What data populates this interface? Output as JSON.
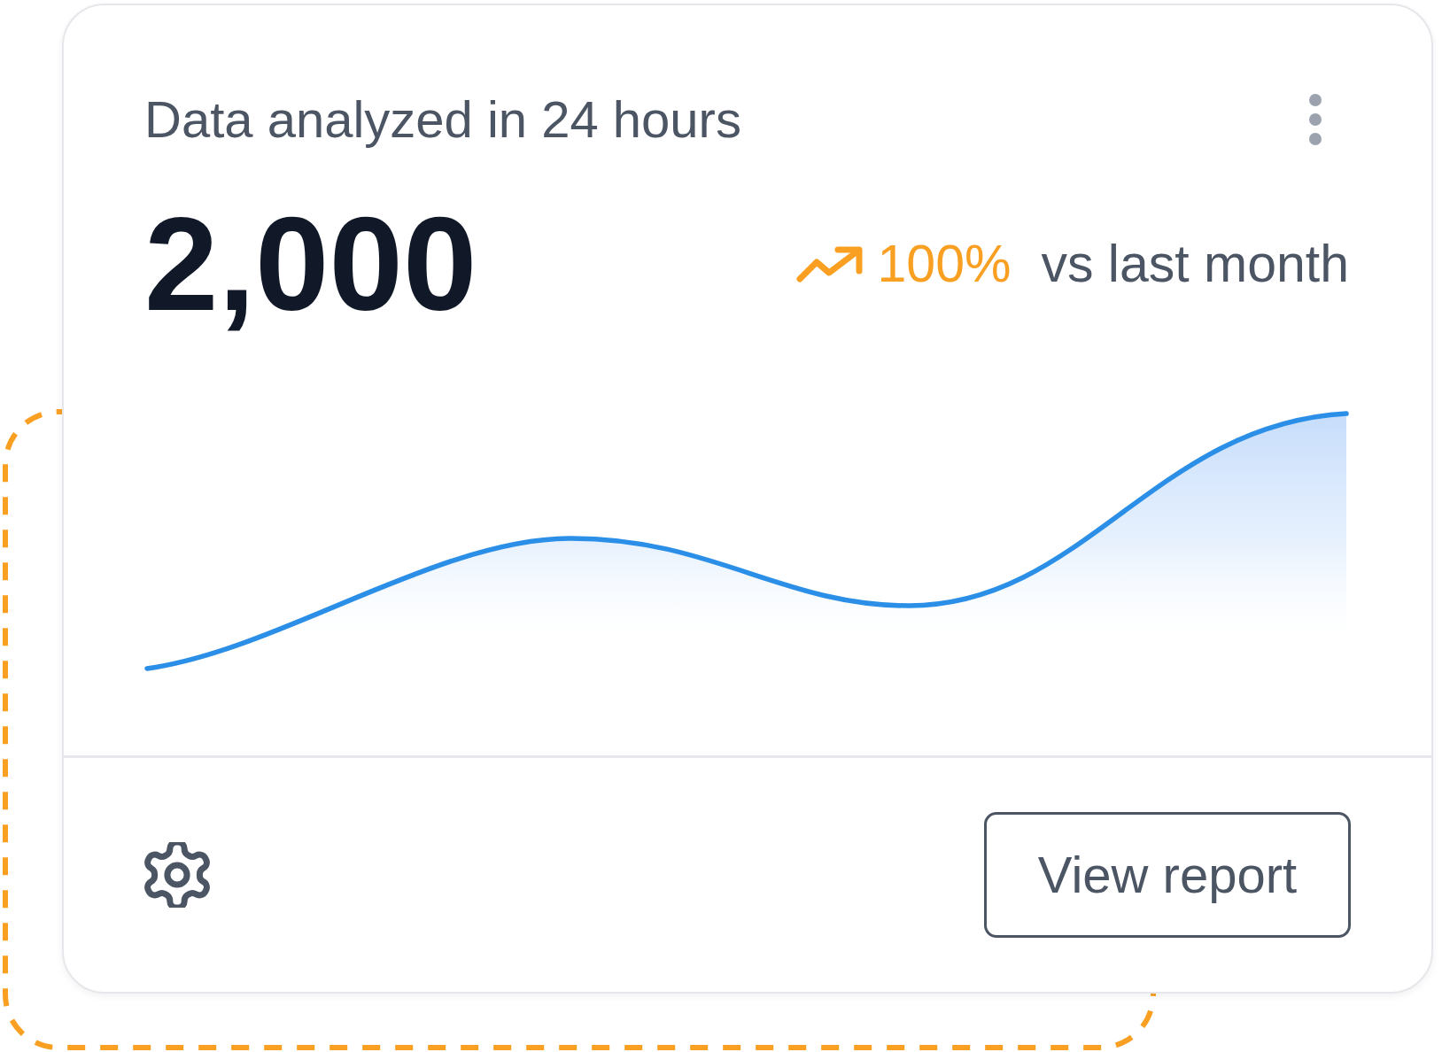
{
  "card": {
    "title": "Data analyzed in 24 hours",
    "value": "2,000",
    "trend": {
      "change": "100%",
      "label": "vs last month"
    },
    "footer": {
      "button": "View report"
    }
  }
}
